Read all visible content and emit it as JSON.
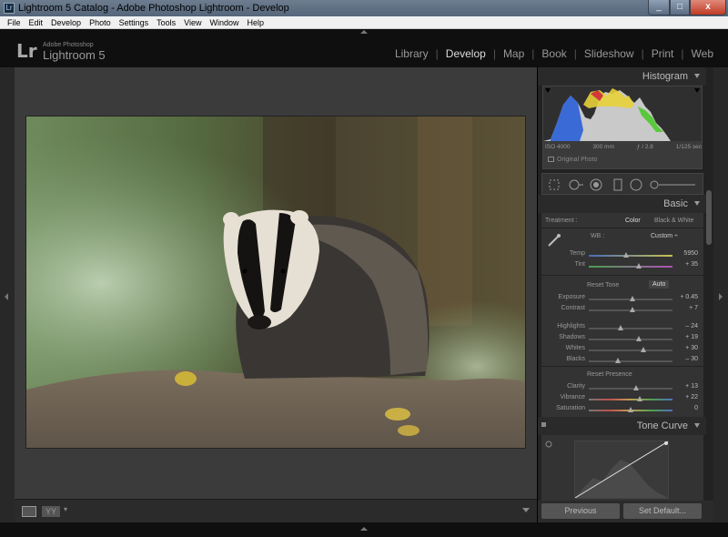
{
  "window": {
    "title": "Lightroom 5 Catalog - Adobe Photoshop Lightroom - Develop",
    "app_icon_text": "Lr",
    "buttons": {
      "minimize": "_",
      "maximize": "□",
      "close": "x"
    }
  },
  "menu": [
    "File",
    "Edit",
    "Develop",
    "Photo",
    "Settings",
    "Tools",
    "View",
    "Window",
    "Help"
  ],
  "brand": {
    "logo": "Lr",
    "small": "Adobe Photoshop",
    "name": "Lightroom 5"
  },
  "modules": [
    {
      "label": "Library",
      "active": false
    },
    {
      "label": "Develop",
      "active": true
    },
    {
      "label": "Map",
      "active": false
    },
    {
      "label": "Book",
      "active": false
    },
    {
      "label": "Slideshow",
      "active": false
    },
    {
      "label": "Print",
      "active": false
    },
    {
      "label": "Web",
      "active": false
    }
  ],
  "module_separator": "|",
  "toolbar": {
    "yy_label": "YY",
    "caret": "▾"
  },
  "histogram": {
    "header": "Histogram",
    "iso": "ISO 4000",
    "focal": "300 mm",
    "aperture": "ƒ / 2.8",
    "shutter": "1/125 sec",
    "original_photo": "Original Photo"
  },
  "basic": {
    "header": "Basic",
    "treatment_label": "Treatment :",
    "treatment_color": "Color",
    "treatment_bw": "Black & White",
    "wb_label": "WB :",
    "wb_value": "Custom ÷",
    "reset_tone": "Reset Tone",
    "auto": "Auto",
    "reset_presence": "Reset Presence",
    "sliders": [
      {
        "name": "Temp",
        "value": "5950",
        "pos": 0.45
      },
      {
        "name": "Tint",
        "value": "+ 35",
        "pos": 0.6
      },
      {
        "name": "Exposure",
        "value": "+ 0.45",
        "pos": 0.52
      },
      {
        "name": "Contrast",
        "value": "+ 7",
        "pos": 0.52
      },
      {
        "name": "Highlights",
        "value": "– 24",
        "pos": 0.38
      },
      {
        "name": "Shadows",
        "value": "+ 19",
        "pos": 0.6
      },
      {
        "name": "Whites",
        "value": "+ 30",
        "pos": 0.65
      },
      {
        "name": "Blacks",
        "value": "– 30",
        "pos": 0.35
      },
      {
        "name": "Clarity",
        "value": "+ 13",
        "pos": 0.56
      },
      {
        "name": "Vibrance",
        "value": "+ 22",
        "pos": 0.61
      },
      {
        "name": "Saturation",
        "value": "0",
        "pos": 0.5
      }
    ]
  },
  "tone_curve": {
    "header": "Tone Curve"
  },
  "buttons": {
    "previous": "Previous",
    "set_default": "Set Default..."
  }
}
